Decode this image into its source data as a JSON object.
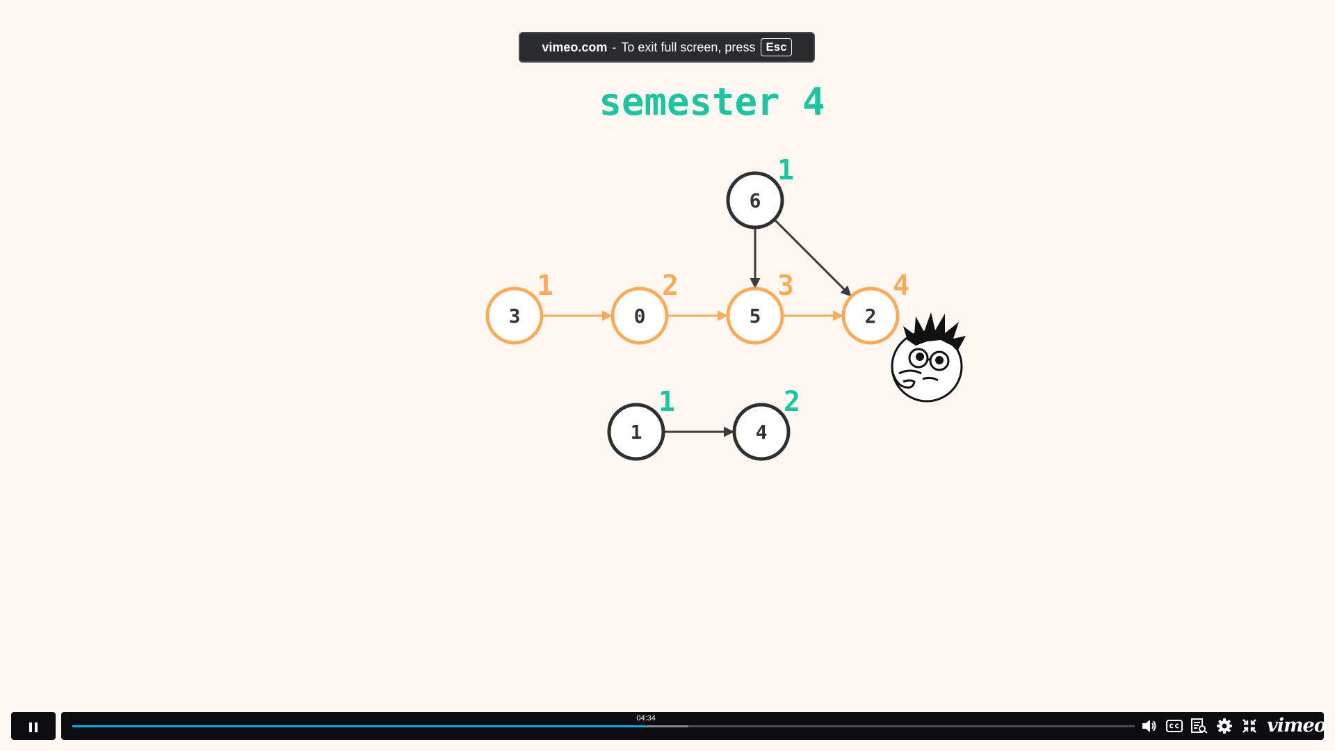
{
  "banner": {
    "site": "vimeo.com",
    "separator": "-",
    "message": "To exit full screen, press",
    "key": "Esc"
  },
  "video": {
    "title": "semester 4",
    "colors": {
      "background": "#fff8f2",
      "teal": "#1ec4a0",
      "orange": "#f7ac5c",
      "dark": "#333333"
    },
    "nodes": [
      {
        "id": "3",
        "label": "3",
        "badge": "1",
        "style": "orange"
      },
      {
        "id": "0",
        "label": "0",
        "badge": "2",
        "style": "orange"
      },
      {
        "id": "5",
        "label": "5",
        "badge": "3",
        "style": "orange"
      },
      {
        "id": "2",
        "label": "2",
        "badge": "4",
        "style": "orange"
      },
      {
        "id": "6",
        "label": "6",
        "badge": "1",
        "style": "teal"
      },
      {
        "id": "1",
        "label": "1",
        "badge": "1",
        "style": "teal"
      },
      {
        "id": "4",
        "label": "4",
        "badge": "2",
        "style": "teal"
      }
    ],
    "edges": [
      {
        "from": "3",
        "to": "0",
        "style": "orange"
      },
      {
        "from": "0",
        "to": "5",
        "style": "orange"
      },
      {
        "from": "5",
        "to": "2",
        "style": "orange"
      },
      {
        "from": "6",
        "to": "5",
        "style": "dark"
      },
      {
        "from": "6",
        "to": "2",
        "style": "dark"
      },
      {
        "from": "1",
        "to": "4",
        "style": "dark"
      }
    ],
    "character": "thinking-face-character"
  },
  "player": {
    "time_tooltip": "04:34",
    "progress_played": 0.54,
    "progress_buffered": 0.58,
    "accent_color": "#00adef",
    "brand": "vimeo",
    "icons": [
      "pause-icon",
      "volume-icon",
      "closed-captions-icon",
      "transcript-icon",
      "settings-icon",
      "exit-fullscreen-icon"
    ]
  }
}
